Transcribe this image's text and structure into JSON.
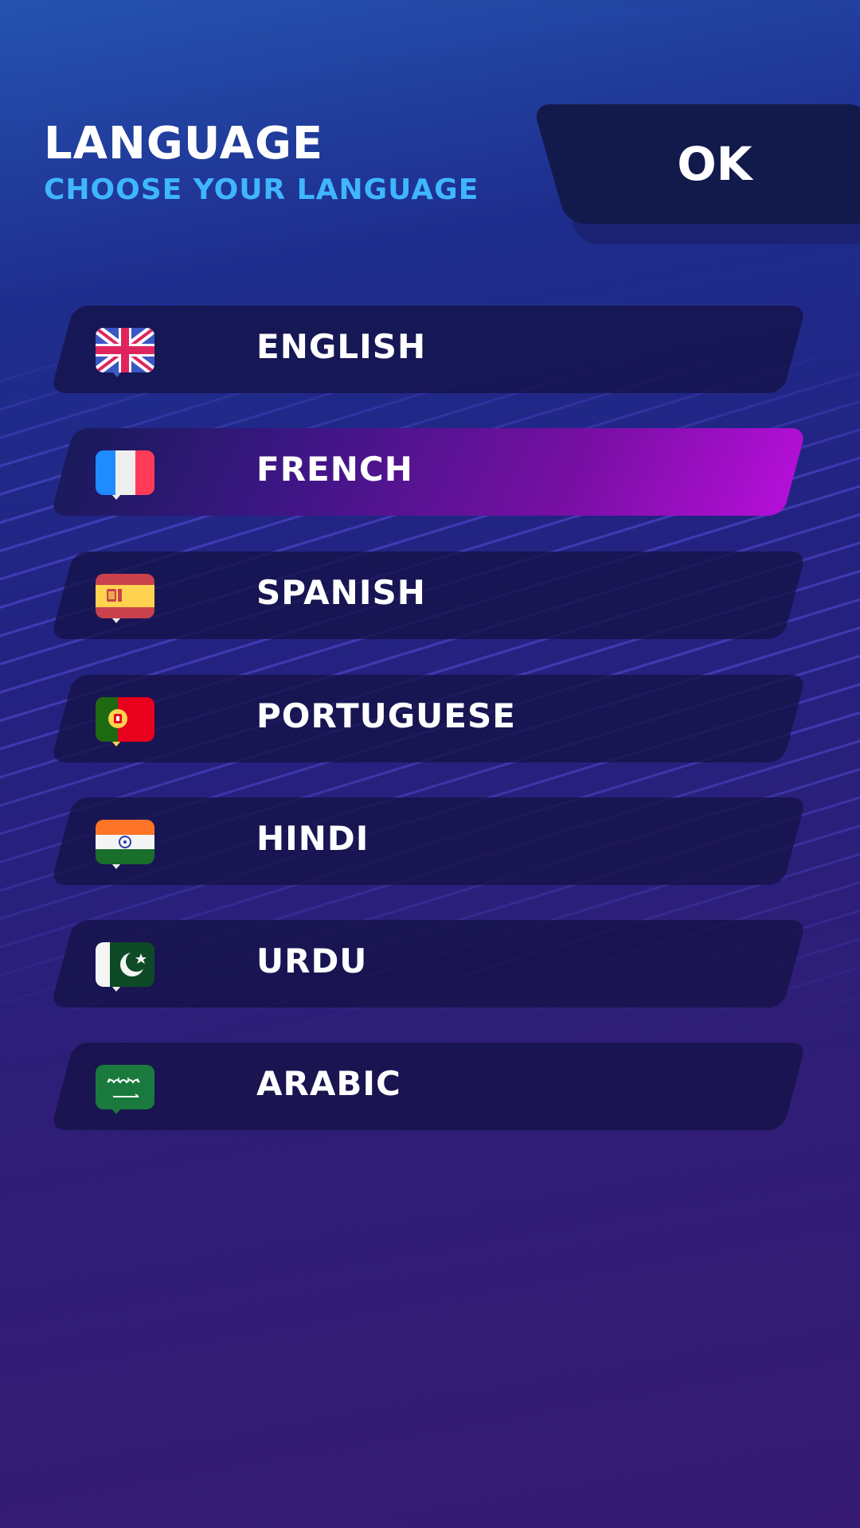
{
  "header": {
    "title": "LANGUAGE",
    "subtitle": "CHOOSE YOUR LANGUAGE",
    "ok_label": "OK"
  },
  "languages": [
    {
      "label": "ENGLISH",
      "flag_icon": "uk-flag-icon",
      "selected": false
    },
    {
      "label": "FRENCH",
      "flag_icon": "france-flag-icon",
      "selected": true
    },
    {
      "label": "SPANISH",
      "flag_icon": "spain-flag-icon",
      "selected": false
    },
    {
      "label": "PORTUGUESE",
      "flag_icon": "portugal-flag-icon",
      "selected": false
    },
    {
      "label": "HINDI",
      "flag_icon": "india-flag-icon",
      "selected": false
    },
    {
      "label": "URDU",
      "flag_icon": "pakistan-flag-icon",
      "selected": false
    },
    {
      "label": "ARABIC",
      "flag_icon": "saudi-arabia-flag-icon",
      "selected": false
    }
  ],
  "colors": {
    "title": "#ffffff",
    "subtitle": "#3fb6ff",
    "ok_button": "#111a4b",
    "row": "#1a1648",
    "selected_gradient_end": "#b50fd8"
  }
}
